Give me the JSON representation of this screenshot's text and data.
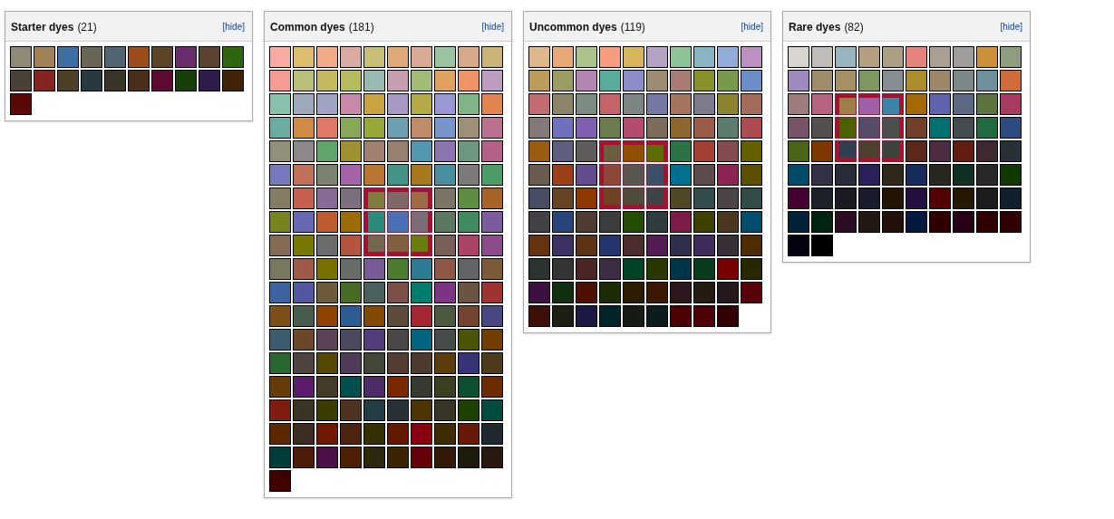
{
  "panels": [
    {
      "title": "Starter dyes",
      "count": "(21)",
      "hide_link": "[hide]",
      "swatches": [
        {
          "color": "#8f8a78",
          "highlighted": false
        },
        {
          "color": "#a08258",
          "highlighted": false
        },
        {
          "color": "#3f6fa5",
          "highlighted": false
        },
        {
          "color": "#6a6655",
          "highlighted": false
        },
        {
          "color": "#526573",
          "highlighted": false
        },
        {
          "color": "#9d4c1c",
          "highlighted": false
        },
        {
          "color": "#5c4526",
          "highlighted": false
        },
        {
          "color": "#6a2d6c",
          "highlighted": false
        },
        {
          "color": "#5a4330",
          "highlighted": false
        },
        {
          "color": "#2e6610",
          "highlighted": false
        },
        {
          "color": "#4a4238",
          "highlighted": false
        },
        {
          "color": "#852420",
          "highlighted": false
        },
        {
          "color": "#4d4028",
          "highlighted": false
        },
        {
          "color": "#283a40",
          "highlighted": false
        },
        {
          "color": "#383428",
          "highlighted": false
        },
        {
          "color": "#4a2e1c",
          "highlighted": false
        },
        {
          "color": "#5e0a32",
          "highlighted": false
        },
        {
          "color": "#173f0a",
          "highlighted": false
        },
        {
          "color": "#311a4c",
          "highlighted": false
        },
        {
          "color": "#3f2208",
          "highlighted": false
        },
        {
          "color": "#5a0808",
          "highlighted": false
        }
      ]
    },
    {
      "title": "Common dyes",
      "count": "(181)",
      "hide_link": "[hide]",
      "swatches": [
        {
          "color": "#f8aba0",
          "highlighted": false
        },
        {
          "color": "#dcbd6e",
          "highlighted": false
        },
        {
          "color": "#f0aa88",
          "highlighted": false
        },
        {
          "color": "#d8aaa0",
          "highlighted": false
        },
        {
          "color": "#c6bf78",
          "highlighted": false
        },
        {
          "color": "#e0aa78",
          "highlighted": false
        },
        {
          "color": "#d8aa94",
          "highlighted": false
        },
        {
          "color": "#9cc4a0",
          "highlighted": false
        },
        {
          "color": "#d8a88a",
          "highlighted": false
        },
        {
          "color": "#ccb478",
          "highlighted": false
        },
        {
          "color": "#f49c94",
          "highlighted": false
        },
        {
          "color": "#b9be7a",
          "highlighted": false
        },
        {
          "color": "#c2b860",
          "highlighted": false
        },
        {
          "color": "#b8bc60",
          "highlighted": false
        },
        {
          "color": "#98bab0",
          "highlighted": false
        },
        {
          "color": "#c89cb0",
          "highlighted": false
        },
        {
          "color": "#a0bc78",
          "highlighted": false
        },
        {
          "color": "#e0a060",
          "highlighted": false
        },
        {
          "color": "#f09468",
          "highlighted": false
        },
        {
          "color": "#bc9cc0",
          "highlighted": false
        },
        {
          "color": "#88c0ac",
          "highlighted": false
        },
        {
          "color": "#a0a8bc",
          "highlighted": false
        },
        {
          "color": "#a0a4c4",
          "highlighted": false
        },
        {
          "color": "#c888a8",
          "highlighted": false
        },
        {
          "color": "#c8a440",
          "highlighted": false
        },
        {
          "color": "#a898c4",
          "highlighted": false
        },
        {
          "color": "#b4aa48",
          "highlighted": false
        },
        {
          "color": "#9898d4",
          "highlighted": false
        },
        {
          "color": "#80b488",
          "highlighted": false
        },
        {
          "color": "#e08450",
          "highlighted": false
        },
        {
          "color": "#6aaca0",
          "highlighted": false
        },
        {
          "color": "#d08a48",
          "highlighted": false
        },
        {
          "color": "#e07868",
          "highlighted": false
        },
        {
          "color": "#88a858",
          "highlighted": false
        },
        {
          "color": "#98a838",
          "highlighted": false
        },
        {
          "color": "#6ca0b0",
          "highlighted": false
        },
        {
          "color": "#c08c68",
          "highlighted": false
        },
        {
          "color": "#7894cc",
          "highlighted": false
        },
        {
          "color": "#9c9078",
          "highlighted": false
        },
        {
          "color": "#bc7090",
          "highlighted": false
        },
        {
          "color": "#90907a",
          "highlighted": false
        },
        {
          "color": "#8c8888",
          "highlighted": false
        },
        {
          "color": "#60a46c",
          "highlighted": false
        },
        {
          "color": "#9c9030",
          "highlighted": false
        },
        {
          "color": "#a08070",
          "highlighted": false
        },
        {
          "color": "#988070",
          "highlighted": false
        },
        {
          "color": "#5498b0",
          "highlighted": false
        },
        {
          "color": "#8c74b0",
          "highlighted": false
        },
        {
          "color": "#6c9880",
          "highlighted": false
        },
        {
          "color": "#b46088",
          "highlighted": false
        },
        {
          "color": "#7878bc",
          "highlighted": false
        },
        {
          "color": "#c07058",
          "highlighted": false
        },
        {
          "color": "#7c8470",
          "highlighted": false
        },
        {
          "color": "#a464a8",
          "highlighted": false
        },
        {
          "color": "#b87430",
          "highlighted": false
        },
        {
          "color": "#449488",
          "highlighted": false
        },
        {
          "color": "#a8781c",
          "highlighted": false
        },
        {
          "color": "#4890a0",
          "highlighted": false
        },
        {
          "color": "#7c7a7a",
          "highlighted": false
        },
        {
          "color": "#4c9c68",
          "highlighted": false
        },
        {
          "color": "#847c64",
          "highlighted": false
        },
        {
          "color": "#c86050",
          "highlighted": false
        },
        {
          "color": "#886c98",
          "highlighted": false
        },
        {
          "color": "#7c7080",
          "highlighted": false
        },
        {
          "color": "#807c40",
          "highlighted": true
        },
        {
          "color": "#806868",
          "highlighted": true
        },
        {
          "color": "#9c6c48",
          "highlighted": true
        },
        {
          "color": "#7c7464",
          "highlighted": false
        },
        {
          "color": "#5e8c40",
          "highlighted": false
        },
        {
          "color": "#a86428",
          "highlighted": false
        },
        {
          "color": "#788420",
          "highlighted": false
        },
        {
          "color": "#6868b4",
          "highlighted": false
        },
        {
          "color": "#bc5c30",
          "highlighted": false
        },
        {
          "color": "#9c6c08",
          "highlighted": false
        },
        {
          "color": "#2c8c7c",
          "highlighted": true
        },
        {
          "color": "#4c70b8",
          "highlighted": true
        },
        {
          "color": "#7c6c78",
          "highlighted": true
        },
        {
          "color": "#5c7860",
          "highlighted": false
        },
        {
          "color": "#408c60",
          "highlighted": false
        },
        {
          "color": "#7c5c9c",
          "highlighted": false
        },
        {
          "color": "#846c54",
          "highlighted": false
        },
        {
          "color": "#787800",
          "highlighted": false
        },
        {
          "color": "#6c6c6c",
          "highlighted": false
        },
        {
          "color": "#b45440",
          "highlighted": false
        },
        {
          "color": "#746850",
          "highlighted": true
        },
        {
          "color": "#806040",
          "highlighted": true
        },
        {
          "color": "#6a7c10",
          "highlighted": true
        },
        {
          "color": "#786058",
          "highlighted": false
        },
        {
          "color": "#ac4468",
          "highlighted": false
        },
        {
          "color": "#8c4c8c",
          "highlighted": false
        },
        {
          "color": "#7a7860",
          "highlighted": false
        },
        {
          "color": "#a05a4a",
          "highlighted": false
        },
        {
          "color": "#787000",
          "highlighted": false
        },
        {
          "color": "#686c68",
          "highlighted": false
        },
        {
          "color": "#785c98",
          "highlighted": false
        },
        {
          "color": "#4c7c30",
          "highlighted": false
        },
        {
          "color": "#2c7c94",
          "highlighted": false
        },
        {
          "color": "#905848",
          "highlighted": false
        },
        {
          "color": "#626468",
          "highlighted": false
        },
        {
          "color": "#7c5c38",
          "highlighted": false
        },
        {
          "color": "#3c64a0",
          "highlighted": false
        },
        {
          "color": "#5458a0",
          "highlighted": false
        },
        {
          "color": "#6c5c3c",
          "highlighted": false
        },
        {
          "color": "#486c24",
          "highlighted": false
        },
        {
          "color": "#4c6060",
          "highlighted": false
        },
        {
          "color": "#7c5048",
          "highlighted": false
        },
        {
          "color": "#007c6c",
          "highlighted": false
        },
        {
          "color": "#7c3484",
          "highlighted": false
        },
        {
          "color": "#6c5444",
          "highlighted": false
        },
        {
          "color": "#9c3430",
          "highlighted": false
        },
        {
          "color": "#7c5018",
          "highlighted": false
        },
        {
          "color": "#485c50",
          "highlighted": false
        },
        {
          "color": "#8c4400",
          "highlighted": false
        },
        {
          "color": "#2c5c90",
          "highlighted": false
        },
        {
          "color": "#804800",
          "highlighted": false
        },
        {
          "color": "#5c4c3c",
          "highlighted": false
        },
        {
          "color": "#a42834",
          "highlighted": false
        },
        {
          "color": "#4c5840",
          "highlighted": false
        },
        {
          "color": "#744430",
          "highlighted": false
        },
        {
          "color": "#484880",
          "highlighted": false
        },
        {
          "color": "#3c5c70",
          "highlighted": false
        },
        {
          "color": "#6c4828",
          "highlighted": false
        },
        {
          "color": "#5c4458",
          "highlighted": false
        },
        {
          "color": "#4c4860",
          "highlighted": false
        },
        {
          "color": "#543c7c",
          "highlighted": false
        },
        {
          "color": "#4c4848",
          "highlighted": false
        },
        {
          "color": "#006480",
          "highlighted": false
        },
        {
          "color": "#484c48",
          "highlighted": false
        },
        {
          "color": "#4c5408",
          "highlighted": false
        },
        {
          "color": "#703c00",
          "highlighted": false
        },
        {
          "color": "#286830",
          "highlighted": false
        },
        {
          "color": "#504440",
          "highlighted": false
        },
        {
          "color": "#544800",
          "highlighted": false
        },
        {
          "color": "#503c58",
          "highlighted": false
        },
        {
          "color": "#444638",
          "highlighted": false
        },
        {
          "color": "#543c30",
          "highlighted": false
        },
        {
          "color": "#4c3c30",
          "highlighted": false
        },
        {
          "color": "#5c3c08",
          "highlighted": false
        },
        {
          "color": "#383478",
          "highlighted": false
        },
        {
          "color": "#4c3c1c",
          "highlighted": false
        },
        {
          "color": "#683c08",
          "highlighted": false
        },
        {
          "color": "#5c1c6c",
          "highlighted": false
        },
        {
          "color": "#443c28",
          "highlighted": false
        },
        {
          "color": "#005050",
          "highlighted": false
        },
        {
          "color": "#4c2c64",
          "highlighted": false
        },
        {
          "color": "#7c2800",
          "highlighted": false
        },
        {
          "color": "#383c30",
          "highlighted": false
        },
        {
          "color": "#3c4020",
          "highlighted": false
        },
        {
          "color": "#0c5030",
          "highlighted": false
        },
        {
          "color": "#6c2c00",
          "highlighted": false
        },
        {
          "color": "#801c10",
          "highlighted": false
        },
        {
          "color": "#3c3424",
          "highlighted": false
        },
        {
          "color": "#3c3c00",
          "highlighted": false
        },
        {
          "color": "#4c3420",
          "highlighted": false
        },
        {
          "color": "#243c44",
          "highlighted": false
        },
        {
          "color": "#283038",
          "highlighted": false
        },
        {
          "color": "#4c3400",
          "highlighted": false
        },
        {
          "color": "#383428",
          "highlighted": false
        },
        {
          "color": "#1c4000",
          "highlighted": false
        },
        {
          "color": "#004c40",
          "highlighted": false
        },
        {
          "color": "#5c2800",
          "highlighted": false
        },
        {
          "color": "#3c2c24",
          "highlighted": false
        },
        {
          "color": "#701800",
          "highlighted": false
        },
        {
          "color": "#4c2410",
          "highlighted": false
        },
        {
          "color": "#343000",
          "highlighted": false
        },
        {
          "color": "#641800",
          "highlighted": false
        },
        {
          "color": "#880010",
          "highlighted": false
        },
        {
          "color": "#3c2c00",
          "highlighted": false
        },
        {
          "color": "#681808",
          "highlighted": false
        },
        {
          "color": "#202830",
          "highlighted": false
        },
        {
          "color": "#003c38",
          "highlighted": false
        },
        {
          "color": "#4c1c08",
          "highlighted": false
        },
        {
          "color": "#4c1048",
          "highlighted": false
        },
        {
          "color": "#4c2000",
          "highlighted": false
        },
        {
          "color": "#2c2810",
          "highlighted": false
        },
        {
          "color": "#3c2400",
          "highlighted": false
        },
        {
          "color": "#640008",
          "highlighted": false
        },
        {
          "color": "#341808",
          "highlighted": false
        },
        {
          "color": "#201c0c",
          "highlighted": false
        },
        {
          "color": "#281810",
          "highlighted": false
        },
        {
          "color": "#400000",
          "highlighted": false
        }
      ]
    },
    {
      "title": "Uncommon dyes",
      "count": "(119)",
      "hide_link": "[hide]",
      "swatches": [
        {
          "color": "#dcb88c",
          "highlighted": false
        },
        {
          "color": "#e8a878",
          "highlighted": false
        },
        {
          "color": "#acc48c",
          "highlighted": false
        },
        {
          "color": "#f89c80",
          "highlighted": false
        },
        {
          "color": "#d8b45c",
          "highlighted": false
        },
        {
          "color": "#b4a4c4",
          "highlighted": false
        },
        {
          "color": "#8cc498",
          "highlighted": false
        },
        {
          "color": "#88b4c4",
          "highlighted": false
        },
        {
          "color": "#94acd8",
          "highlighted": false
        },
        {
          "color": "#bc90c0",
          "highlighted": false
        },
        {
          "color": "#bc9c5c",
          "highlighted": false
        },
        {
          "color": "#9c9c64",
          "highlighted": false
        },
        {
          "color": "#b484b4",
          "highlighted": false
        },
        {
          "color": "#58ac9c",
          "highlighted": false
        },
        {
          "color": "#8c8cc8",
          "highlighted": false
        },
        {
          "color": "#9c8c74",
          "highlighted": false
        },
        {
          "color": "#a87c74",
          "highlighted": false
        },
        {
          "color": "#88902c",
          "highlighted": false
        },
        {
          "color": "#78984c",
          "highlighted": false
        },
        {
          "color": "#6c8cc8",
          "highlighted": false
        },
        {
          "color": "#c06c70",
          "highlighted": false
        },
        {
          "color": "#8c8468",
          "highlighted": false
        },
        {
          "color": "#7c8c80",
          "highlighted": false
        },
        {
          "color": "#c46468",
          "highlighted": false
        },
        {
          "color": "#7c8484",
          "highlighted": false
        },
        {
          "color": "#7878a4",
          "highlighted": false
        },
        {
          "color": "#a4745c",
          "highlighted": false
        },
        {
          "color": "#7c7c8c",
          "highlighted": false
        },
        {
          "color": "#8c8430",
          "highlighted": false
        },
        {
          "color": "#a46c5c",
          "highlighted": false
        },
        {
          "color": "#847878",
          "highlighted": false
        },
        {
          "color": "#7070bc",
          "highlighted": false
        },
        {
          "color": "#8060b0",
          "highlighted": false
        },
        {
          "color": "#6c7c4c",
          "highlighted": false
        },
        {
          "color": "#b44c70",
          "highlighted": false
        },
        {
          "color": "#7c6c5c",
          "highlighted": false
        },
        {
          "color": "#8c6830",
          "highlighted": false
        },
        {
          "color": "#9c5c4c",
          "highlighted": false
        },
        {
          "color": "#5c7c6c",
          "highlighted": false
        },
        {
          "color": "#ac4c50",
          "highlighted": false
        },
        {
          "color": "#9c5c10",
          "highlighted": false
        },
        {
          "color": "#60607c",
          "highlighted": false
        },
        {
          "color": "#605c5c",
          "highlighted": false
        },
        {
          "color": "#6c5c40",
          "highlighted": true
        },
        {
          "color": "#8c5000",
          "highlighted": true
        },
        {
          "color": "#5c6c00",
          "highlighted": true
        },
        {
          "color": "#2c7448",
          "highlighted": false
        },
        {
          "color": "#a44034",
          "highlighted": false
        },
        {
          "color": "#844c4c",
          "highlighted": false
        },
        {
          "color": "#646000",
          "highlighted": false
        },
        {
          "color": "#6c5c50",
          "highlighted": false
        },
        {
          "color": "#9c4018",
          "highlighted": false
        },
        {
          "color": "#644c8c",
          "highlighted": false
        },
        {
          "color": "#8c4838",
          "highlighted": true
        },
        {
          "color": "#585850",
          "highlighted": true
        },
        {
          "color": "#3c5068",
          "highlighted": true
        },
        {
          "color": "#007090",
          "highlighted": false
        },
        {
          "color": "#5c4c4c",
          "highlighted": false
        },
        {
          "color": "#8c2454",
          "highlighted": false
        },
        {
          "color": "#5c5000",
          "highlighted": false
        },
        {
          "color": "#484c64",
          "highlighted": false
        },
        {
          "color": "#644424",
          "highlighted": false
        },
        {
          "color": "#8c3800",
          "highlighted": false
        },
        {
          "color": "#6c4424",
          "highlighted": true
        },
        {
          "color": "#4c4c3c",
          "highlighted": true
        },
        {
          "color": "#404448",
          "highlighted": true
        },
        {
          "color": "#504824",
          "highlighted": false
        },
        {
          "color": "#344c4c",
          "highlighted": false
        },
        {
          "color": "#4c4448",
          "highlighted": false
        },
        {
          "color": "#344c48",
          "highlighted": false
        },
        {
          "color": "#444048",
          "highlighted": false
        },
        {
          "color": "#28447c",
          "highlighted": false
        },
        {
          "color": "#503c30",
          "highlighted": false
        },
        {
          "color": "#3c3c3c",
          "highlighted": false
        },
        {
          "color": "#244c04",
          "highlighted": false
        },
        {
          "color": "#303c40",
          "highlighted": false
        },
        {
          "color": "#7c1c48",
          "highlighted": false
        },
        {
          "color": "#404000",
          "highlighted": false
        },
        {
          "color": "#4c3820",
          "highlighted": false
        },
        {
          "color": "#004c6c",
          "highlighted": false
        },
        {
          "color": "#643410",
          "highlighted": false
        },
        {
          "color": "#3c3064",
          "highlighted": false
        },
        {
          "color": "#5c3414",
          "highlighted": false
        },
        {
          "color": "#24346c",
          "highlighted": false
        },
        {
          "color": "#4c2c2c",
          "highlighted": false
        },
        {
          "color": "#541c54",
          "highlighted": false
        },
        {
          "color": "#30304c",
          "highlighted": false
        },
        {
          "color": "#402c5c",
          "highlighted": false
        },
        {
          "color": "#383038",
          "highlighted": false
        },
        {
          "color": "#4c2c00",
          "highlighted": false
        },
        {
          "color": "#2c3430",
          "highlighted": false
        },
        {
          "color": "#343434",
          "highlighted": false
        },
        {
          "color": "#4c2424",
          "highlighted": false
        },
        {
          "color": "#3c2c44",
          "highlighted": false
        },
        {
          "color": "#004428",
          "highlighted": false
        },
        {
          "color": "#283800",
          "highlighted": false
        },
        {
          "color": "#003448",
          "highlighted": false
        },
        {
          "color": "#083c1c",
          "highlighted": false
        },
        {
          "color": "#780000",
          "highlighted": false
        },
        {
          "color": "#282800",
          "highlighted": false
        },
        {
          "color": "#3c1040",
          "highlighted": false
        },
        {
          "color": "#103010",
          "highlighted": false
        },
        {
          "color": "#501000",
          "highlighted": false
        },
        {
          "color": "#1c2c00",
          "highlighted": false
        },
        {
          "color": "#2c1c00",
          "highlighted": false
        },
        {
          "color": "#3c1800",
          "highlighted": false
        },
        {
          "color": "#2c181c",
          "highlighted": false
        },
        {
          "color": "#241c10",
          "highlighted": false
        },
        {
          "color": "#24181c",
          "highlighted": false
        },
        {
          "color": "#580008",
          "highlighted": false
        },
        {
          "color": "#3c1008",
          "highlighted": false
        },
        {
          "color": "#1c2014",
          "highlighted": false
        },
        {
          "color": "#1c1844",
          "highlighted": false
        },
        {
          "color": "#002428",
          "highlighted": false
        },
        {
          "color": "#141c14",
          "highlighted": false
        },
        {
          "color": "#0c1c1c",
          "highlighted": false
        },
        {
          "color": "#4c0004",
          "highlighted": false
        },
        {
          "color": "#4c0008",
          "highlighted": false
        },
        {
          "color": "#300004",
          "highlighted": false
        }
      ]
    },
    {
      "title": "Rare dyes",
      "count": "(82)",
      "hide_link": "[hide]",
      "swatches": [
        {
          "color": "#d8d4d0",
          "highlighted": false
        },
        {
          "color": "#c0bcb8",
          "highlighted": false
        },
        {
          "color": "#98b4bc",
          "highlighted": false
        },
        {
          "color": "#b4a080",
          "highlighted": false
        },
        {
          "color": "#aca084",
          "highlighted": false
        },
        {
          "color": "#e4847c",
          "highlighted": false
        },
        {
          "color": "#aca094",
          "highlighted": false
        },
        {
          "color": "#a09c9c",
          "highlighted": false
        },
        {
          "color": "#cc9038",
          "highlighted": false
        },
        {
          "color": "#909c80",
          "highlighted": false
        },
        {
          "color": "#a088c0",
          "highlighted": false
        },
        {
          "color": "#9c8c6c",
          "highlighted": false
        },
        {
          "color": "#a49064",
          "highlighted": false
        },
        {
          "color": "#7c9860",
          "highlighted": false
        },
        {
          "color": "#848c94",
          "highlighted": false
        },
        {
          "color": "#ac8c2c",
          "highlighted": false
        },
        {
          "color": "#9c8868",
          "highlighted": false
        },
        {
          "color": "#7c8888",
          "highlighted": false
        },
        {
          "color": "#6c909c",
          "highlighted": false
        },
        {
          "color": "#d06c3c",
          "highlighted": false
        },
        {
          "color": "#9c7c7c",
          "highlighted": false
        },
        {
          "color": "#b86480",
          "highlighted": false
        },
        {
          "color": "#9c8048",
          "highlighted": true
        },
        {
          "color": "#a060a8",
          "highlighted": true
        },
        {
          "color": "#3c84a8",
          "highlighted": true
        },
        {
          "color": "#a46808",
          "highlighted": false
        },
        {
          "color": "#6064ac",
          "highlighted": false
        },
        {
          "color": "#5c6884",
          "highlighted": false
        },
        {
          "color": "#5c7440",
          "highlighted": false
        },
        {
          "color": "#a83c60",
          "highlighted": false
        },
        {
          "color": "#785468",
          "highlighted": false
        },
        {
          "color": "#545050",
          "highlighted": false
        },
        {
          "color": "#4c6000",
          "highlighted": true
        },
        {
          "color": "#544c68",
          "highlighted": true
        },
        {
          "color": "#4c504c",
          "highlighted": true
        },
        {
          "color": "#704028",
          "highlighted": false
        },
        {
          "color": "#007070",
          "highlighted": false
        },
        {
          "color": "#444c50",
          "highlighted": false
        },
        {
          "color": "#206c40",
          "highlighted": false
        },
        {
          "color": "#2c4c80",
          "highlighted": false
        },
        {
          "color": "#4c6418",
          "highlighted": false
        },
        {
          "color": "#7c3800",
          "highlighted": false
        },
        {
          "color": "#2c4050",
          "highlighted": true
        },
        {
          "color": "#4c4030",
          "highlighted": true
        },
        {
          "color": "#3c443c",
          "highlighted": true
        },
        {
          "color": "#5c281c",
          "highlighted": false
        },
        {
          "color": "#4c2c40",
          "highlighted": false
        },
        {
          "color": "#641c10",
          "highlighted": false
        },
        {
          "color": "#402830",
          "highlighted": false
        },
        {
          "color": "#283038",
          "highlighted": false
        },
        {
          "color": "#004c68",
          "highlighted": false
        },
        {
          "color": "#343048",
          "highlighted": false
        },
        {
          "color": "#282c38",
          "highlighted": false
        },
        {
          "color": "#2c2058",
          "highlighted": false
        },
        {
          "color": "#302818",
          "highlighted": false
        },
        {
          "color": "#182c5c",
          "highlighted": false
        },
        {
          "color": "#282820",
          "highlighted": false
        },
        {
          "color": "#103024",
          "highlighted": false
        },
        {
          "color": "#282828",
          "highlighted": false
        },
        {
          "color": "#103800",
          "highlighted": false
        },
        {
          "color": "#440030",
          "highlighted": false
        },
        {
          "color": "#1c2028",
          "highlighted": false
        },
        {
          "color": "#1c1824",
          "highlighted": false
        },
        {
          "color": "#181c2c",
          "highlighted": false
        },
        {
          "color": "#241404",
          "highlighted": false
        },
        {
          "color": "#241040",
          "highlighted": false
        },
        {
          "color": "#540000",
          "highlighted": false
        },
        {
          "color": "#241800",
          "highlighted": false
        },
        {
          "color": "#1c1c1c",
          "highlighted": false
        },
        {
          "color": "#10202c",
          "highlighted": false
        },
        {
          "color": "#002038",
          "highlighted": false
        },
        {
          "color": "#002410",
          "highlighted": false
        },
        {
          "color": "#2c0c24",
          "highlighted": false
        },
        {
          "color": "#241814",
          "highlighted": false
        },
        {
          "color": "#241008",
          "highlighted": false
        },
        {
          "color": "#041840",
          "highlighted": false
        },
        {
          "color": "#300000",
          "highlighted": false
        },
        {
          "color": "#280018",
          "highlighted": false
        },
        {
          "color": "#300000",
          "highlighted": false
        },
        {
          "color": "#300004",
          "highlighted": false
        },
        {
          "color": "#040410",
          "highlighted": false
        },
        {
          "color": "#000000",
          "highlighted": false
        }
      ]
    }
  ]
}
